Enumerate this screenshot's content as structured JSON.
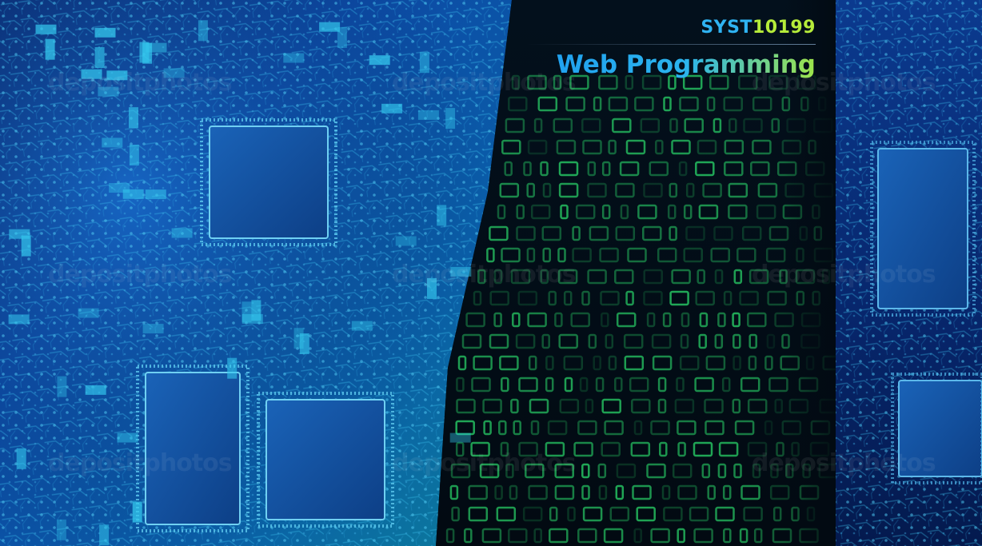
{
  "slide": {
    "course_code_prefix": "SYST",
    "course_code_number": "10199",
    "course_name": "Web Programming",
    "watermark_text": "depositphotos"
  },
  "colors": {
    "background_dark": "#020c1e",
    "board_blue": "#0a3c8c",
    "trace_cyan": "#34c8ee",
    "binary_green": "#2dea72",
    "code_blue": "#2fb3f2",
    "code_green": "#b6ec3a"
  },
  "icons": {
    "chip": "integrated-circuit-chip-icon",
    "binary": "binary-digits-pattern"
  }
}
